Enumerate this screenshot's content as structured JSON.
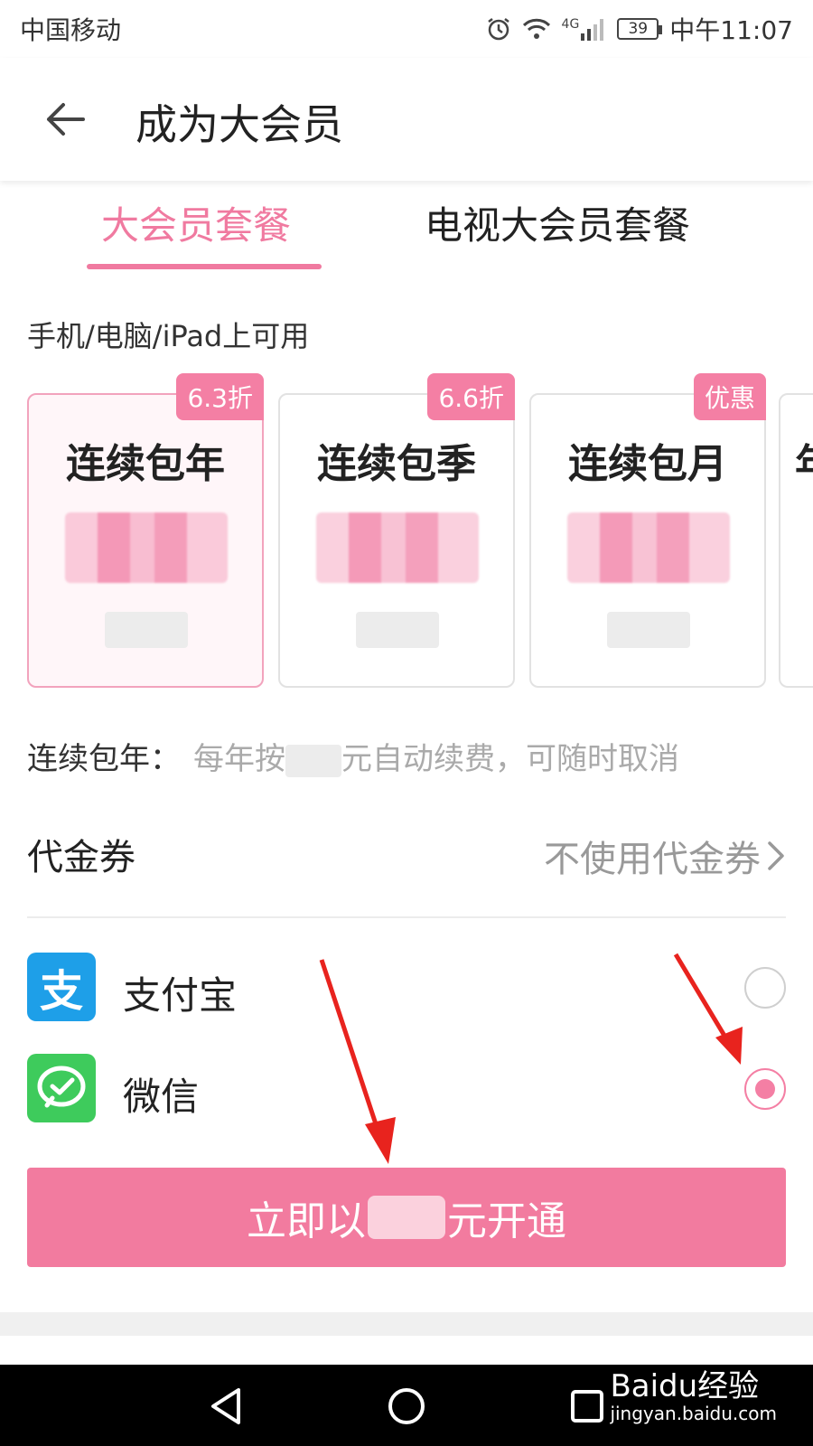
{
  "status_bar": {
    "carrier": "中国移动",
    "network": "4G",
    "battery": "39",
    "time": "中午11:07"
  },
  "header": {
    "title": "成为大会员"
  },
  "tabs": [
    {
      "label": "大会员套餐",
      "active": true
    },
    {
      "label": "电视大会员套餐",
      "active": false
    }
  ],
  "availability_text": "手机/电脑/iPad上可用",
  "plans": [
    {
      "name": "连续包年",
      "badge": "6.3折",
      "selected": true
    },
    {
      "name": "连续包季",
      "badge": "6.6折",
      "selected": false
    },
    {
      "name": "连续包月",
      "badge": "优惠",
      "selected": false
    },
    {
      "name": "年",
      "badge": "",
      "selected": false
    }
  ],
  "plan_description": {
    "label": "连续包年：",
    "prefix": "每年按",
    "suffix": "元自动续费，可随时取消"
  },
  "coupon": {
    "label": "代金券",
    "value": "不使用代金券"
  },
  "payment_methods": [
    {
      "name": "支付宝",
      "icon": "alipay-icon",
      "icon_glyph": "支",
      "selected": false
    },
    {
      "name": "微信",
      "icon": "wechat-icon",
      "selected": true
    }
  ],
  "pay_button": {
    "prefix": "立即以",
    "suffix": "元开通"
  },
  "watermark": {
    "line1": "Baidu经验",
    "line2": "jingyan.baidu.com"
  },
  "colors": {
    "accent_pink": "#f47fa4",
    "alipay_blue": "#1e9fe8",
    "wechat_green": "#3ecb5c",
    "annotation_red": "#e8231e"
  }
}
